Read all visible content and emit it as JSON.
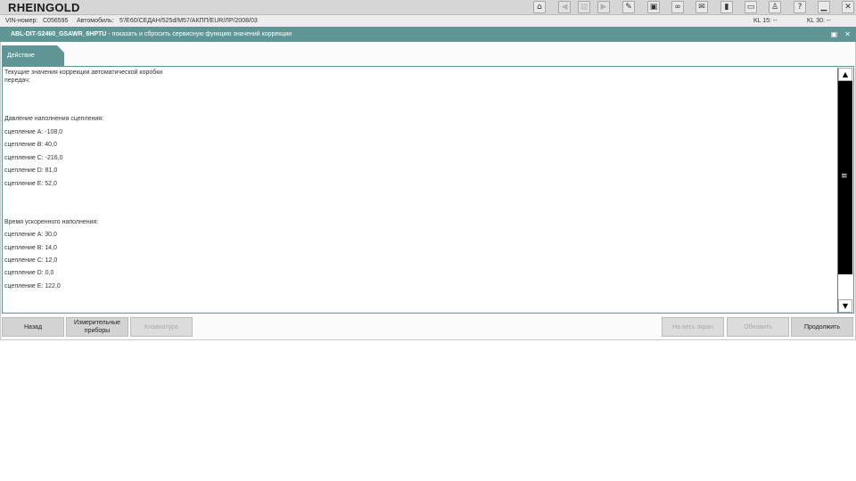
{
  "app": {
    "title": "RHEINGOLD"
  },
  "toolbar": {
    "home": "⌂",
    "back": "◀",
    "doc": "▤",
    "forward": "▶",
    "wrench": "✎",
    "car": "▣",
    "link": "∞",
    "mail": "✉",
    "battery": "▮",
    "print": "▭",
    "person": "♙",
    "help": "?",
    "minimize": "▁",
    "close": "✕"
  },
  "info": {
    "vin_label": "VIN-номер:",
    "vin_value": "C056595",
    "car_label": "Автомобиль:",
    "car_value": "5'/E60/СЕДАН/525d/M57/АКПП/EUR/ЛР/2008/03",
    "kl15": "KL 15:  --",
    "kl30": "KL 30:  --"
  },
  "header": {
    "code": "ABL-DIT-S2460_GSAWR_6HPTU",
    "description": "- показать и сбросить сервисную функцию значений коррекции",
    "save_icon": "▣",
    "close_icon": "✕"
  },
  "tab": {
    "label": "Действие"
  },
  "content": {
    "lines": [
      "Текущие значения коррекции автоматической коробки",
      "передач:",
      "Давление наполнения сцепления:",
      "сцепление A: -108,0",
      "сцепление B: 40,0",
      "сцепление C: -216,0",
      "сцепление D: 81,0",
      "сцепление E: 52,0",
      "Время ускоренного наполнения:",
      "сцепление A: 30,0",
      "сцепление B: 14,0",
      "сцепление C: 12,0",
      "сцепление D: 0,0",
      "сцепление E: 122,0"
    ]
  },
  "scrollbar": {
    "up": "▲",
    "down": "▼",
    "grip": "≡"
  },
  "buttons": {
    "back": "Назад",
    "measure": "Измерительные приборы",
    "keyboard": "Клавиатура",
    "fullscreen": "На весь экран",
    "refresh": "Обновить",
    "continue": "Продолжить"
  }
}
